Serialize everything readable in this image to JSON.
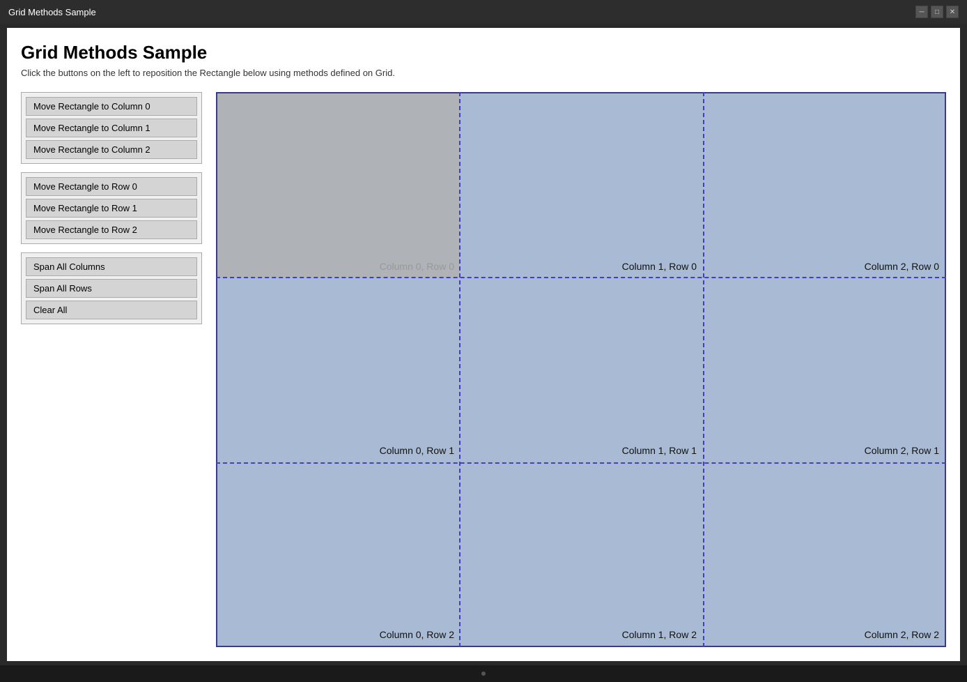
{
  "titleBar": {
    "title": "Grid Methods Sample",
    "controls": [
      "minimize",
      "maximize",
      "close"
    ]
  },
  "page": {
    "title": "Grid Methods Sample",
    "subtitle": "Click the buttons on the left to reposition the Rectangle below using methods defined on Grid."
  },
  "controls": {
    "columnGroup": {
      "buttons": [
        {
          "id": "col0",
          "label": "Move Rectangle to Column 0"
        },
        {
          "id": "col1",
          "label": "Move Rectangle to Column 1"
        },
        {
          "id": "col2",
          "label": "Move Rectangle to Column 2"
        }
      ]
    },
    "rowGroup": {
      "buttons": [
        {
          "id": "row0",
          "label": "Move Rectangle to Row 0"
        },
        {
          "id": "row1",
          "label": "Move Rectangle to Row 1"
        },
        {
          "id": "row2",
          "label": "Move Rectangle to Row 2"
        }
      ]
    },
    "spanGroup": {
      "buttons": [
        {
          "id": "spanCols",
          "label": "Span All Columns"
        },
        {
          "id": "spanRows",
          "label": "Span All Rows"
        },
        {
          "id": "clearAll",
          "label": "Clear All"
        }
      ]
    }
  },
  "gridCells": [
    {
      "col": 0,
      "row": 0,
      "label": "Column 0, Row 0",
      "hasRect": true
    },
    {
      "col": 1,
      "row": 0,
      "label": "Column 1, Row 0",
      "hasRect": false
    },
    {
      "col": 2,
      "row": 0,
      "label": "Column 2, Row 0",
      "hasRect": false
    },
    {
      "col": 0,
      "row": 1,
      "label": "Column 0, Row 1",
      "hasRect": false
    },
    {
      "col": 1,
      "row": 1,
      "label": "Column 1, Row 1",
      "hasRect": false
    },
    {
      "col": 2,
      "row": 1,
      "label": "Column 2, Row 1",
      "hasRect": false
    },
    {
      "col": 0,
      "row": 2,
      "label": "Column 0, Row 2",
      "hasRect": false
    },
    {
      "col": 1,
      "row": 2,
      "label": "Column 1, Row 2",
      "hasRect": false
    },
    {
      "col": 2,
      "row": 2,
      "label": "Column 2, Row 2",
      "hasRect": false
    }
  ]
}
